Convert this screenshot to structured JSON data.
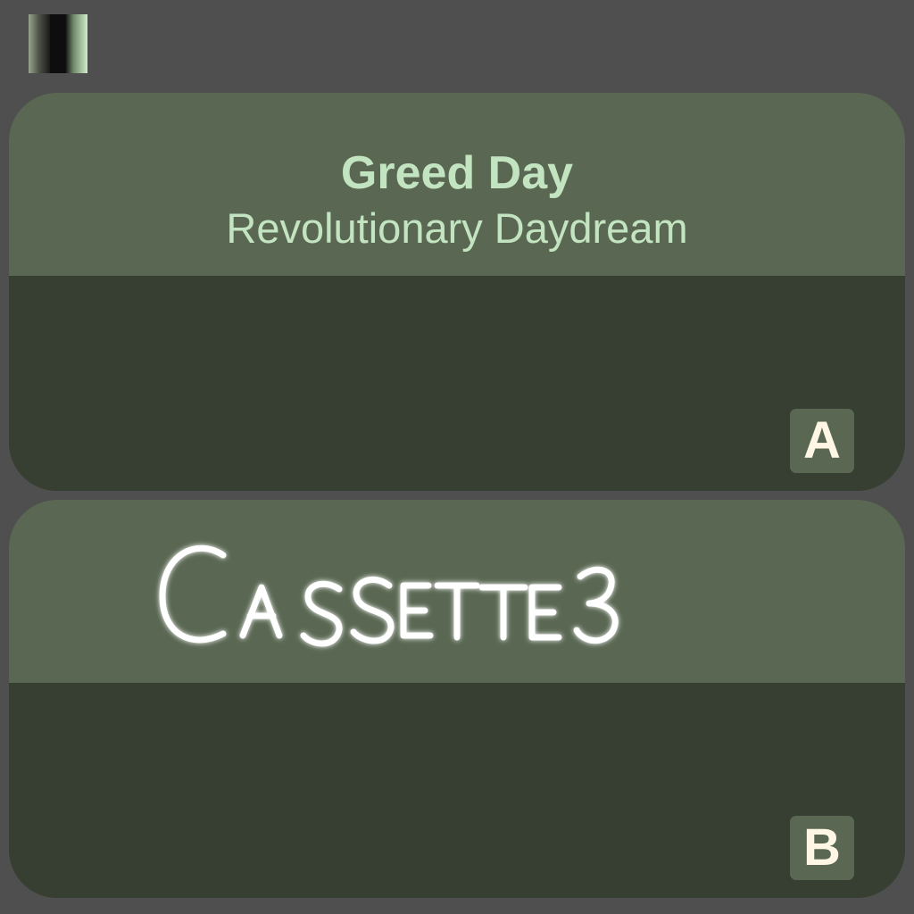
{
  "controls": {
    "pause_icon": "pause-icon"
  },
  "cassette_a": {
    "artist": "Greed Day",
    "song": "Revolutionary Daydream",
    "side": "A"
  },
  "cassette_b": {
    "handwritten_title": "Cassette 3",
    "side": "B"
  },
  "colors": {
    "background": "#4f4f4f",
    "label": "#5a6853",
    "deck": "#373f33",
    "label_text": "#c3e4c0",
    "side_text": "#fff6e6"
  }
}
